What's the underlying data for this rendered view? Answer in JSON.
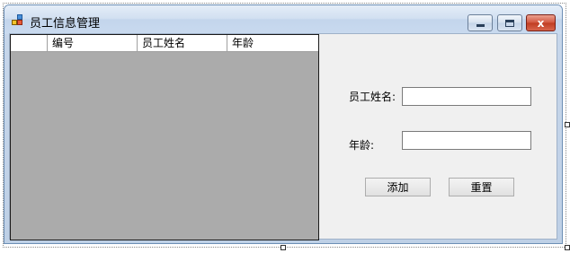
{
  "window": {
    "title": "员工信息管理",
    "controls": {
      "minimize": "",
      "maximize": "",
      "close": "x"
    }
  },
  "grid": {
    "columns": [
      "编号",
      "员工姓名",
      "年龄"
    ],
    "rows": []
  },
  "form": {
    "name_label": "员工姓名:",
    "name_value": "",
    "age_label": "年龄:",
    "age_value": "",
    "add_button": "添加",
    "reset_button": "重置"
  },
  "colors": {
    "grid_background": "#ababab",
    "client_background": "#f0f0f0",
    "close_button": "#c03c22"
  }
}
